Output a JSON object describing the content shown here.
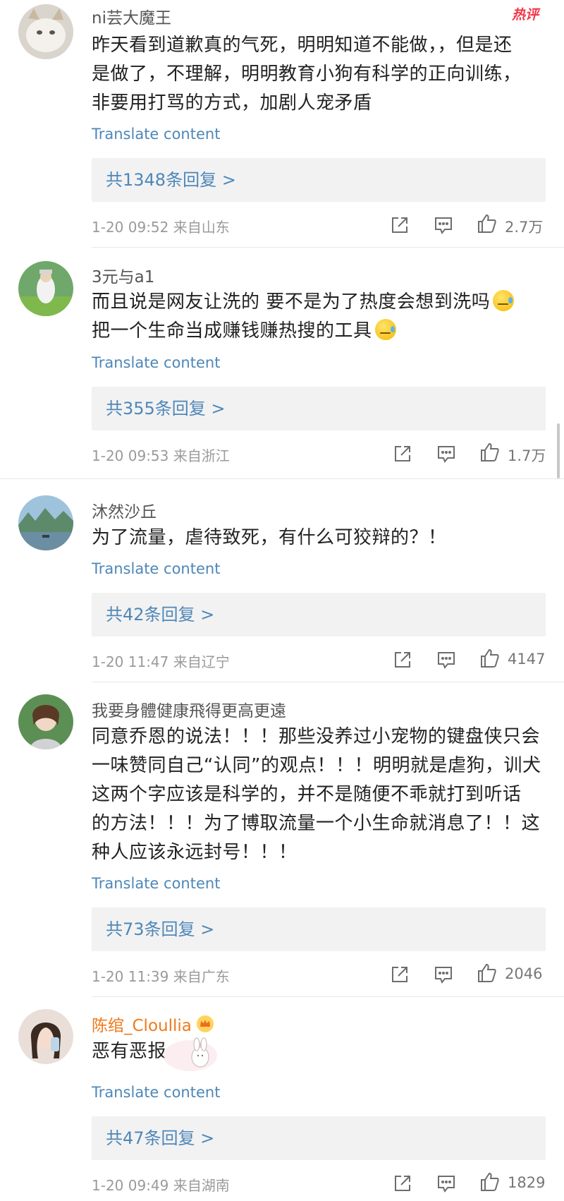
{
  "comments": [
    {
      "username": "ni芸大魔王",
      "hot_badge": "热评",
      "lines": [
        "昨天看到道歉真的气死，明明知道不能做，，但是还",
        "是做了，不理解，明明教育小狗有科学的正向训练，",
        "非要用打骂的方式，加剧人宠矛盾"
      ],
      "translate": "Translate content",
      "replies": "共1348条回复 >",
      "meta": "1-20 09:52  来自山东",
      "likes": "2.7万"
    },
    {
      "username": "3元与a1",
      "lines": [
        "而且说是网友让洗的 要不是为了热度会想到洗吗",
        "把一个生命当成赚钱赚热搜的工具"
      ],
      "translate": "Translate content",
      "replies": "共355条回复 >",
      "meta": "1-20 09:53  来自浙江",
      "likes": "1.7万"
    },
    {
      "username": "沐然沙丘",
      "lines": [
        "为了流量，虐待致死，有什么可狡辩的？！"
      ],
      "translate": "Translate content",
      "replies": "共42条回复 >",
      "meta": "1-20 11:47  来自辽宁",
      "likes": "4147"
    },
    {
      "username": "我要身體健康飛得更高更遠",
      "lines": [
        "同意乔恩的说法！！！那些没养过小宠物的键盘侠只会",
        "一味赞同自己“认同”的观点！！！明明就是虐狗，训犬",
        "这两个字应该是科学的，并不是随便不乖就打到听话",
        "的方法！！！为了博取流量一个小生命就消息了！！这",
        "种人应该永远封号！！！"
      ],
      "translate": "Translate content",
      "replies": "共73条回复 >",
      "meta": "1-20 11:39  来自广东",
      "likes": "2046"
    },
    {
      "username": "陈绾_Cloullia",
      "lines": [
        "恶有恶报"
      ],
      "translate": "Translate content",
      "replies": "共47条回复 >",
      "meta": "1-20 09:49  来自湖南",
      "likes": "1829"
    }
  ],
  "icons": {
    "share": "share-icon",
    "reply": "comment-icon",
    "like": "thumbs-up-icon"
  },
  "colors": {
    "link": "#4e87b8",
    "hot": "#f2384a",
    "vip_name": "#f07a1a"
  }
}
